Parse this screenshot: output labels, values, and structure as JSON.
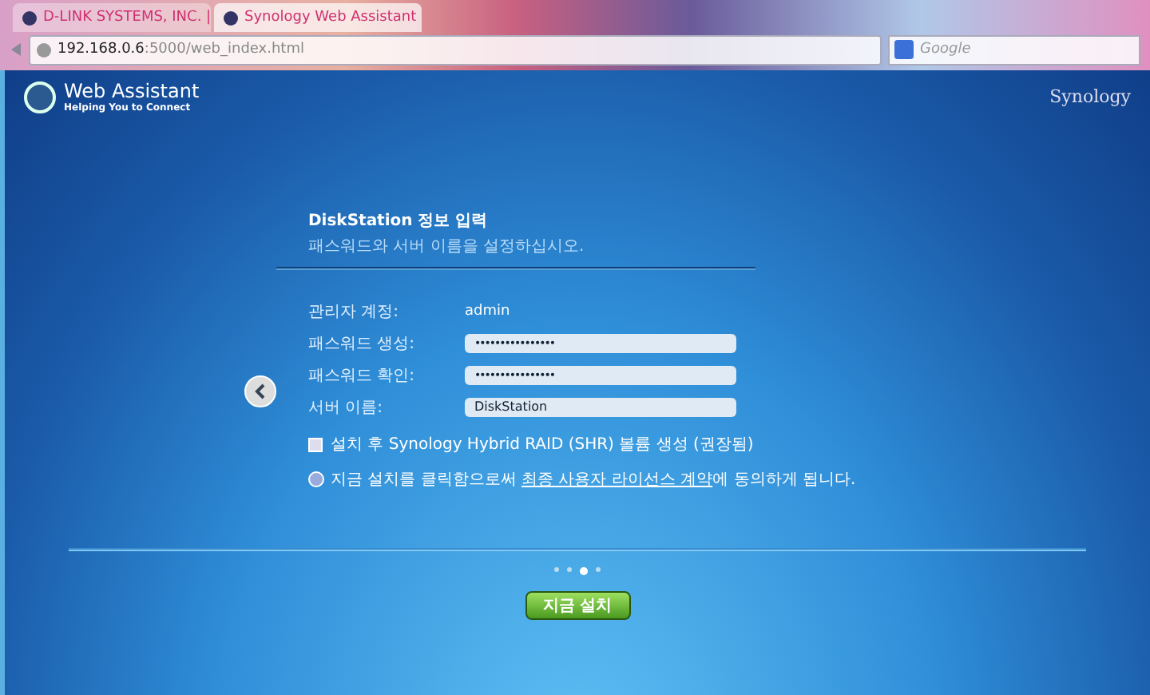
{
  "browser": {
    "tabs": [
      {
        "label": "D-LINK SYSTEMS, INC. |",
        "selected": false
      },
      {
        "label": "Synology Web Assistant",
        "selected": true
      }
    ],
    "address": {
      "host": "192.168.0.6",
      "path": ":5000/web_index.html"
    },
    "search": {
      "placeholder": "Google"
    }
  },
  "header": {
    "title": "Web Assistant",
    "tagline": "Helping You to Connect",
    "brand": "Synology"
  },
  "form": {
    "title": "DiskStation 정보 입력",
    "subtitle": "패스워드와 서버 이름을 설정하십시오.",
    "fields": [
      {
        "kind": "text",
        "label": "관리자 계정:",
        "value": "admin"
      },
      {
        "kind": "password",
        "label": "패스워드 생성:",
        "value": "••••••••••••••••"
      },
      {
        "kind": "password",
        "label": "패스워드 확인:",
        "value": "••••••••••••••••"
      },
      {
        "kind": "input",
        "label": "서버 이름:",
        "value": "DiskStation"
      }
    ],
    "option": {
      "label": "설치 후 Synology Hybrid RAID (SHR) 볼륨 생성 (권장됨)",
      "checked": false
    },
    "notice": {
      "before": "지금 설치를 클릭함으로써 ",
      "link": "최종 사용자 라이선스 계약",
      "after": "에 동의하게 됩니다."
    }
  },
  "pager": [
    {
      "selected": false
    },
    {
      "selected": false
    },
    {
      "selected": true
    },
    {
      "selected": false
    }
  ],
  "install_button": "지금 설치"
}
